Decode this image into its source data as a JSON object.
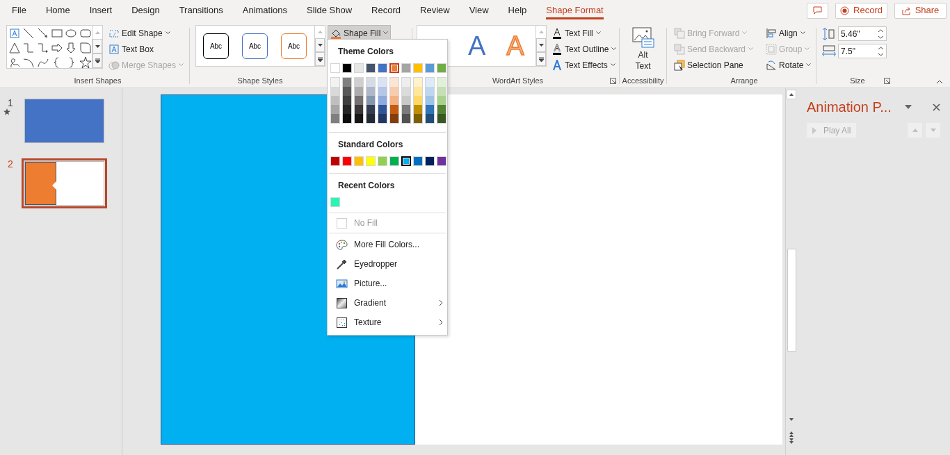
{
  "tabs": [
    {
      "label": "File",
      "selected": false
    },
    {
      "label": "Home",
      "selected": false
    },
    {
      "label": "Insert",
      "selected": false
    },
    {
      "label": "Design",
      "selected": false
    },
    {
      "label": "Transitions",
      "selected": false
    },
    {
      "label": "Animations",
      "selected": false
    },
    {
      "label": "Slide Show",
      "selected": false
    },
    {
      "label": "Record",
      "selected": false
    },
    {
      "label": "Review",
      "selected": false
    },
    {
      "label": "View",
      "selected": false
    },
    {
      "label": "Help",
      "selected": false
    },
    {
      "label": "Shape Format",
      "selected": true
    }
  ],
  "top_buttons": {
    "record": "Record",
    "share": "Share"
  },
  "ribbon": {
    "insert_shapes": {
      "label": "Insert Shapes",
      "commands": [
        {
          "kind": "edit",
          "label": "Edit Shape",
          "disabled": false,
          "dropdown": true
        },
        {
          "kind": "textbox",
          "label": "Text Box",
          "disabled": false,
          "dropdown": false
        },
        {
          "kind": "merge",
          "label": "Merge Shapes",
          "disabled": true,
          "dropdown": true
        }
      ]
    },
    "shape_styles": {
      "label": "Shape Styles",
      "samples": [
        {
          "text": "Abc",
          "color": "#000000"
        },
        {
          "text": "Abc",
          "color": "#4472c4"
        },
        {
          "text": "Abc",
          "color": "#ed7d31"
        }
      ],
      "shape_fill": {
        "label": "Shape Fill",
        "expanded": true
      }
    },
    "wordart": {
      "label": "WordArt Styles",
      "samples": [
        {
          "text": "A",
          "kind": "solid",
          "color": "#4472c4"
        },
        {
          "text": "A",
          "kind": "outline",
          "color": "#f4b183"
        }
      ],
      "commands": [
        {
          "kind": "fill",
          "label": "Text Fill"
        },
        {
          "kind": "outline",
          "label": "Text Outline"
        },
        {
          "kind": "effects",
          "label": "Text Effects"
        }
      ]
    },
    "accessibility": {
      "label": "Accessibility",
      "alt_text": [
        "Alt",
        "Text"
      ]
    },
    "arrange": {
      "label": "Arrange",
      "commands": [
        {
          "kind": "forward",
          "label": "Bring Forward",
          "disabled": true,
          "dropdown": true
        },
        {
          "kind": "backward",
          "label": "Send Backward",
          "disabled": true,
          "dropdown": true
        },
        {
          "kind": "selection",
          "label": "Selection Pane",
          "disabled": false,
          "dropdown": false
        },
        {
          "kind": "align",
          "label": "Align",
          "disabled": false,
          "dropdown": true
        },
        {
          "kind": "group",
          "label": "Group",
          "disabled": true,
          "dropdown": true
        },
        {
          "kind": "rotate",
          "label": "Rotate",
          "disabled": false,
          "dropdown": true
        }
      ]
    },
    "size": {
      "label": "Size",
      "height": "5.46\"",
      "width": "7.5\""
    }
  },
  "fill_menu": {
    "theme_heading": "Theme Colors",
    "theme_colors": [
      {
        "color": "#ffffff",
        "selected": false
      },
      {
        "color": "#000000",
        "selected": false
      },
      {
        "color": "#e7e6e6",
        "selected": false
      },
      {
        "color": "#44546a",
        "selected": false
      },
      {
        "color": "#4472c4",
        "selected": false
      },
      {
        "color": "#ed7d31",
        "selected": true
      },
      {
        "color": "#a5a5a5",
        "selected": false
      },
      {
        "color": "#ffc000",
        "selected": false
      },
      {
        "color": "#5b9bd5",
        "selected": false
      },
      {
        "color": "#70ad47",
        "selected": false
      }
    ],
    "theme_shades": [
      {
        "shades": [
          {
            "color": "#f2f2f2"
          },
          {
            "color": "#d9d9d9"
          },
          {
            "color": "#bfbfbf"
          },
          {
            "color": "#a6a6a6"
          },
          {
            "color": "#7f7f7f"
          }
        ]
      },
      {
        "shades": [
          {
            "color": "#7f7f7f"
          },
          {
            "color": "#595959"
          },
          {
            "color": "#3f3f3f"
          },
          {
            "color": "#262626"
          },
          {
            "color": "#0d0d0d"
          }
        ]
      },
      {
        "shades": [
          {
            "color": "#d0cece"
          },
          {
            "color": "#aeabab"
          },
          {
            "color": "#757171"
          },
          {
            "color": "#3a3838"
          },
          {
            "color": "#171616"
          }
        ]
      },
      {
        "shades": [
          {
            "color": "#d6dce5"
          },
          {
            "color": "#adb9ca"
          },
          {
            "color": "#8497b0"
          },
          {
            "color": "#333f50"
          },
          {
            "color": "#222a35"
          }
        ]
      },
      {
        "shades": [
          {
            "color": "#dae3f3"
          },
          {
            "color": "#b4c7e7"
          },
          {
            "color": "#8faadc"
          },
          {
            "color": "#2f5597"
          },
          {
            "color": "#203864"
          }
        ]
      },
      {
        "shades": [
          {
            "color": "#fbe5d6"
          },
          {
            "color": "#f8cbad"
          },
          {
            "color": "#f4b183"
          },
          {
            "color": "#c55a11"
          },
          {
            "color": "#843c0c"
          }
        ]
      },
      {
        "shades": [
          {
            "color": "#ededed"
          },
          {
            "color": "#dbdbdb"
          },
          {
            "color": "#c9c9c9"
          },
          {
            "color": "#7b7b7b"
          },
          {
            "color": "#525252"
          }
        ]
      },
      {
        "shades": [
          {
            "color": "#fff2cc"
          },
          {
            "color": "#ffe699"
          },
          {
            "color": "#ffd966"
          },
          {
            "color": "#bf9000"
          },
          {
            "color": "#7f6000"
          }
        ]
      },
      {
        "shades": [
          {
            "color": "#deebf7"
          },
          {
            "color": "#bdd7ee"
          },
          {
            "color": "#9dc3e6"
          },
          {
            "color": "#2e75b6"
          },
          {
            "color": "#1f4e79"
          }
        ]
      },
      {
        "shades": [
          {
            "color": "#e2f0d9"
          },
          {
            "color": "#c5e0b4"
          },
          {
            "color": "#a9d18e"
          },
          {
            "color": "#548235"
          },
          {
            "color": "#385723"
          }
        ]
      }
    ],
    "standard_heading": "Standard Colors",
    "standard_colors": [
      {
        "color": "#c00000",
        "selected": false
      },
      {
        "color": "#ff0000",
        "selected": false
      },
      {
        "color": "#ffc000",
        "selected": false
      },
      {
        "color": "#ffff00",
        "selected": false
      },
      {
        "color": "#92d050",
        "selected": false
      },
      {
        "color": "#00b050",
        "selected": false
      },
      {
        "color": "#00b0f0",
        "selected": true
      },
      {
        "color": "#0070c0",
        "selected": false
      },
      {
        "color": "#002060",
        "selected": false
      },
      {
        "color": "#7030a0",
        "selected": false
      }
    ],
    "recent_heading": "Recent Colors",
    "recent_colors": [
      {
        "color": "#29f5b5",
        "selected": false
      }
    ],
    "items": [
      {
        "kind": "nofill",
        "label": "No Fill",
        "disabled": true,
        "submenu": false
      },
      {
        "kind": "more",
        "label": "More Fill Colors...",
        "disabled": false,
        "submenu": false
      },
      {
        "kind": "eyedropper",
        "label": "Eyedropper",
        "disabled": false,
        "submenu": false
      },
      {
        "kind": "picture",
        "label": "Picture...",
        "disabled": false,
        "submenu": false
      },
      {
        "kind": "gradient",
        "label": "Gradient",
        "disabled": false,
        "submenu": true
      },
      {
        "kind": "texture",
        "label": "Texture",
        "disabled": false,
        "submenu": true
      }
    ]
  },
  "slides": [
    {
      "number": "1",
      "selected": false,
      "animated": true,
      "kind": "blue"
    },
    {
      "number": "2",
      "selected": true,
      "animated": false,
      "kind": "split"
    }
  ],
  "animation_pane": {
    "title": "Animation P...",
    "play_all": {
      "label": "Play All",
      "disabled": true
    }
  }
}
